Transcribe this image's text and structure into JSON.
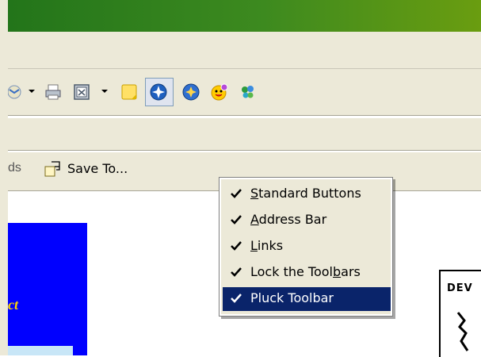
{
  "links_bar": {
    "truncated_text": "ds",
    "save_to_label": "Save To..."
  },
  "toolbar": {
    "icons": [
      "mail-icon",
      "print-icon",
      "edit-icon",
      "note-icon",
      "pluck-icon",
      "pluck-refresh-icon",
      "messenger-icon",
      "butterfly-icon"
    ]
  },
  "context_menu": {
    "items": [
      {
        "label_pre": "",
        "label_key": "S",
        "label_post": "tandard Buttons",
        "checked": true,
        "selected": false
      },
      {
        "label_pre": "",
        "label_key": "A",
        "label_post": "ddress Bar",
        "checked": true,
        "selected": false
      },
      {
        "label_pre": "",
        "label_key": "L",
        "label_post": "inks",
        "checked": true,
        "selected": false
      },
      {
        "label_pre": "Lock the Tool",
        "label_key": "b",
        "label_post": "ars",
        "checked": true,
        "selected": false
      },
      {
        "label_pre": "Pluck Toolbar",
        "label_key": "",
        "label_post": "",
        "checked": true,
        "selected": true
      }
    ]
  },
  "page": {
    "banner_text": "ct",
    "card_text": "DEV"
  },
  "colors": {
    "title_bar": "#2e7d1b",
    "menu_selection": "#0a246a",
    "banner_blue": "#0000ff",
    "banner_text": "#ffd800"
  }
}
